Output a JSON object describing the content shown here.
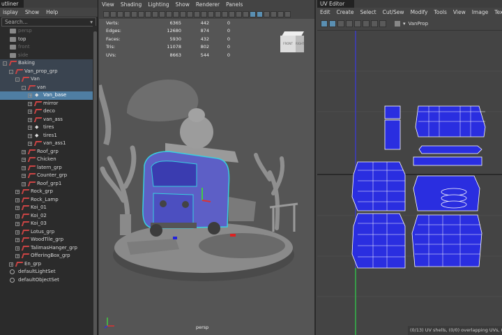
{
  "outliner": {
    "tab": "utliner",
    "menu": [
      "isplay",
      "Show",
      "Help"
    ],
    "search_placeholder": "Search...",
    "items": [
      {
        "label": "persp",
        "depth": 0,
        "icon": "camera-icon",
        "dim": true
      },
      {
        "label": "top",
        "depth": 0,
        "icon": "camera-icon",
        "dim": false
      },
      {
        "label": "front",
        "depth": 0,
        "icon": "camera-icon",
        "dim": true
      },
      {
        "label": "side",
        "depth": 0,
        "icon": "camera-icon",
        "dim": true
      },
      {
        "label": "Baking",
        "depth": 0,
        "icon": "group-icon",
        "expand": "-",
        "state": "hl"
      },
      {
        "label": "Van_prop_grp",
        "depth": 1,
        "icon": "group-icon",
        "expand": "-",
        "state": "hl"
      },
      {
        "label": "Van",
        "depth": 2,
        "icon": "group-icon",
        "expand": "-",
        "state": "hl"
      },
      {
        "label": "van",
        "depth": 3,
        "icon": "group-icon",
        "expand": "-",
        "state": "hl"
      },
      {
        "label": "Van_base",
        "depth": 4,
        "icon": "mesh-icon",
        "expand": "+",
        "state": "sel"
      },
      {
        "label": "mirror",
        "depth": 4,
        "icon": "group-icon",
        "expand": "+"
      },
      {
        "label": "deco",
        "depth": 4,
        "icon": "group-icon",
        "expand": "+"
      },
      {
        "label": "van_ass",
        "depth": 4,
        "icon": "group-icon",
        "expand": "+"
      },
      {
        "label": "tires",
        "depth": 4,
        "icon": "mesh-icon",
        "expand": "+"
      },
      {
        "label": "tires1",
        "depth": 4,
        "icon": "mesh-icon",
        "expand": "+"
      },
      {
        "label": "van_ass1",
        "depth": 4,
        "icon": "group-icon",
        "expand": "+"
      },
      {
        "label": "Roof_grp",
        "depth": 3,
        "icon": "group-icon",
        "expand": "+"
      },
      {
        "label": "Chicken",
        "depth": 3,
        "icon": "group-icon",
        "expand": "+"
      },
      {
        "label": "latern_grp",
        "depth": 3,
        "icon": "group-icon",
        "expand": "+"
      },
      {
        "label": "Counter_grp",
        "depth": 3,
        "icon": "group-icon",
        "expand": "+"
      },
      {
        "label": "Roof_grp1",
        "depth": 3,
        "icon": "group-icon",
        "expand": "+"
      },
      {
        "label": "Rock_grp",
        "depth": 2,
        "icon": "group-icon",
        "expand": "+"
      },
      {
        "label": "Rock_Lamp",
        "depth": 2,
        "icon": "group-icon",
        "expand": "+"
      },
      {
        "label": "Koi_01",
        "depth": 2,
        "icon": "group-icon",
        "expand": "+"
      },
      {
        "label": "Koi_02",
        "depth": 2,
        "icon": "group-icon",
        "expand": "+"
      },
      {
        "label": "Koi_03",
        "depth": 2,
        "icon": "group-icon",
        "expand": "+"
      },
      {
        "label": "Lotus_grp",
        "depth": 2,
        "icon": "group-icon",
        "expand": "+"
      },
      {
        "label": "WoodTile_grp",
        "depth": 2,
        "icon": "group-icon",
        "expand": "+"
      },
      {
        "label": "TalimasHanger_grp",
        "depth": 2,
        "icon": "group-icon",
        "expand": "+"
      },
      {
        "label": "OfferingBox_grp",
        "depth": 2,
        "icon": "group-icon",
        "expand": "+"
      },
      {
        "label": "En_grp",
        "depth": 1,
        "icon": "group-icon",
        "expand": "+"
      },
      {
        "label": "defaultLightSet",
        "depth": 0,
        "icon": "set-icon"
      },
      {
        "label": "defaultObjectSet",
        "depth": 0,
        "icon": "set-icon"
      }
    ]
  },
  "viewport": {
    "menu": [
      "View",
      "Shading",
      "Lighting",
      "Show",
      "Renderer",
      "Panels"
    ],
    "stats": [
      {
        "label": "Verts:",
        "total": "6365",
        "selected": "442",
        "comp": "0"
      },
      {
        "label": "Edges:",
        "total": "12680",
        "selected": "874",
        "comp": "0"
      },
      {
        "label": "Faces:",
        "total": "5930",
        "selected": "432",
        "comp": "0"
      },
      {
        "label": "Tris:",
        "total": "11078",
        "selected": "802",
        "comp": "0"
      },
      {
        "label": "UVs:",
        "total": "8663",
        "selected": "544",
        "comp": "0"
      }
    ],
    "viewcube": {
      "front": "FRONT",
      "right": "RIGHT"
    },
    "camera": "persp"
  },
  "uv_editor": {
    "tab": "UV Editor",
    "menu": [
      "Edit",
      "Create",
      "Select",
      "Cut/Sew",
      "Modify",
      "Tools",
      "View",
      "Image",
      "Textures"
    ],
    "uv_set": "VanProp",
    "status": "(0/13) UV shells, (0/0) overlapping UVs, (",
    "colors": {
      "shell_fill": "#2a2ee0",
      "shell_edge": "#ffffff",
      "grid_axis_v": "#3b3bd8",
      "grid_axis_h": "#111111"
    }
  }
}
